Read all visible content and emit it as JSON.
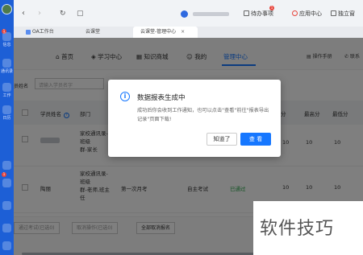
{
  "rail": {
    "labels": [
      "信息",
      "通讯录",
      "工作",
      "日历"
    ],
    "badges": [
      "1",
      "1"
    ]
  },
  "browser": {
    "tools": {
      "todo_label": "待办事项",
      "todo_badge": "1",
      "app_center_label": "应用中心",
      "standalone_label": "独立窗"
    },
    "tabs": [
      {
        "label": "OA工作台"
      },
      {
        "label": "云课堂"
      },
      {
        "label": "云课堂-管理中心"
      }
    ]
  },
  "site_nav": {
    "items": [
      "首页",
      "学习中心",
      "知识商城",
      "我的",
      "管理中心"
    ],
    "active_index": 4,
    "right_items": [
      "操作手册",
      "联系"
    ]
  },
  "filter": {
    "label": "员姓名",
    "placeholder": "请输入学员名字"
  },
  "table": {
    "headers": [
      "学员姓名",
      "部门",
      "分",
      "最高分",
      "最低分"
    ],
    "rows": [
      {
        "name_hidden": true,
        "dept_lines": [
          "家校通讯录-",
          "班级",
          "群-家长"
        ],
        "exam": "",
        "type": "",
        "status": "",
        "score": "10",
        "max": "10",
        "min": "10"
      },
      {
        "name": "陶丽",
        "dept_lines": [
          "家校通讯录-",
          "班级",
          "群-老师,班主",
          "任"
        ],
        "exam": "第一次月考",
        "type": "自主考试",
        "status": "已通过",
        "score": "10",
        "max": "10",
        "min": "10"
      }
    ]
  },
  "bottom_bar": {
    "buttons": [
      "通过考试(已选0)",
      "取消操作(已选0)",
      "全部取消报名"
    ]
  },
  "modal": {
    "title": "数据报表生成中",
    "message": "成功后你会收到工作通知，也可以点击\"查看\"前往\"报表导出记录\"页面下载!",
    "cancel_label": "知道了",
    "confirm_label": "查 看",
    "accent": "#1677ff"
  },
  "watermark": {
    "text": "软件技巧"
  }
}
